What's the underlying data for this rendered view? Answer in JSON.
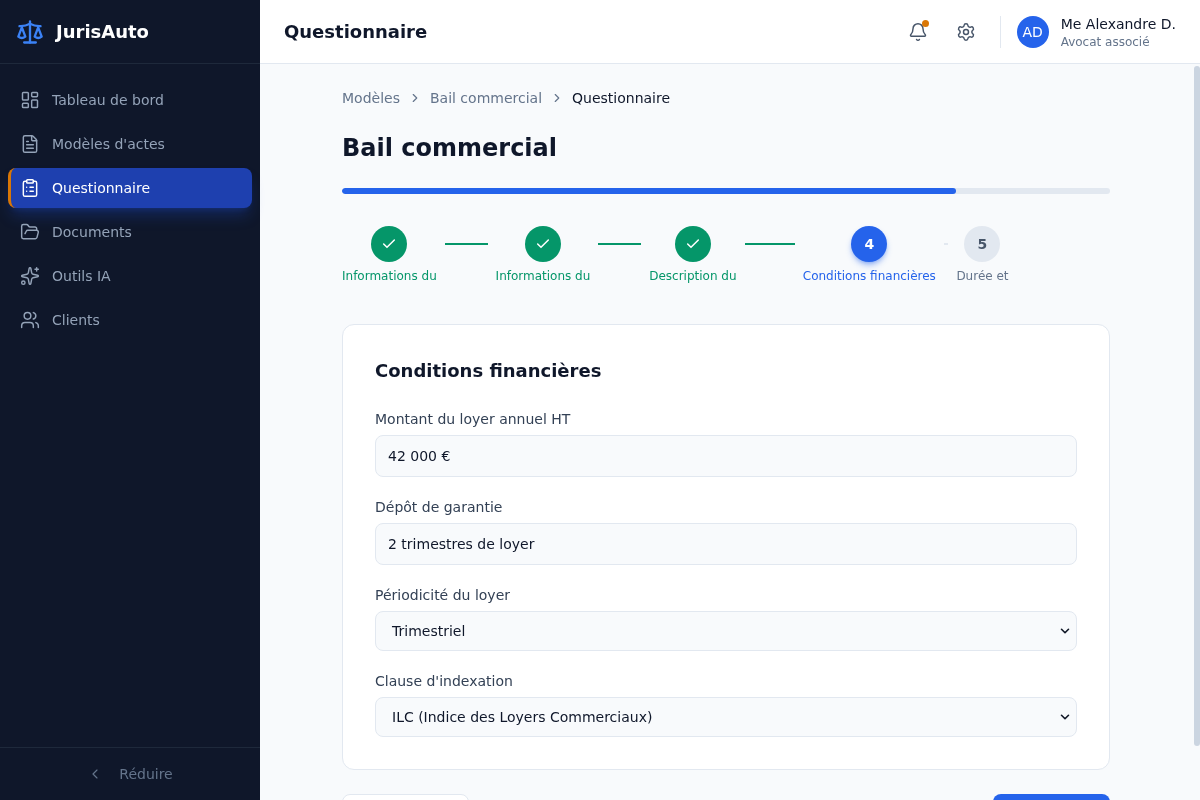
{
  "app": {
    "name": "JurisAuto"
  },
  "sidebar": {
    "items": [
      {
        "label": "Tableau de bord",
        "selected": false
      },
      {
        "label": "Modèles d'actes",
        "selected": false
      },
      {
        "label": "Questionnaire",
        "selected": true
      },
      {
        "label": "Documents",
        "selected": false
      },
      {
        "label": "Outils IA",
        "selected": false
      },
      {
        "label": "Clients",
        "selected": false
      }
    ],
    "collapse": {
      "label": "Réduire"
    }
  },
  "header": {
    "title": "Questionnaire",
    "notifications": {
      "unread": true
    },
    "user": {
      "initials": "AD",
      "name": "Me Alexandre D.",
      "role": "Avocat associé"
    }
  },
  "breadcrumb": [
    {
      "label": "Modèles",
      "current": false
    },
    {
      "label": "Bail commercial",
      "current": false
    },
    {
      "label": "Questionnaire",
      "current": true
    }
  ],
  "page_title": "Bail commercial",
  "progress": {
    "level": 0.8
  },
  "steps": [
    {
      "label": "Informations du",
      "completed": true,
      "selected": false
    },
    {
      "label": "Informations du",
      "completed": true,
      "selected": false
    },
    {
      "label": "Description du",
      "completed": true,
      "selected": false
    },
    {
      "label": "Conditions financières",
      "number": "4",
      "completed": false,
      "selected": true
    },
    {
      "label": "Durée et",
      "number": "5",
      "completed": false,
      "selected": false
    }
  ],
  "form": {
    "title": "Conditions financières",
    "fields": [
      {
        "kind": "input",
        "label": "Montant du loyer annuel HT",
        "value": "42 000 €"
      },
      {
        "kind": "input",
        "label": "Dépôt de garantie",
        "value": "2 trimestres de loyer"
      },
      {
        "kind": "select",
        "label": "Périodicité du loyer",
        "value": "Trimestriel"
      },
      {
        "kind": "select",
        "label": "Clause d'indexation",
        "value": "ILC (Indice des Loyers Commerciaux)"
      }
    ]
  },
  "actions": [
    {
      "kind": "secondary"
    },
    {
      "kind": "primary"
    }
  ]
}
